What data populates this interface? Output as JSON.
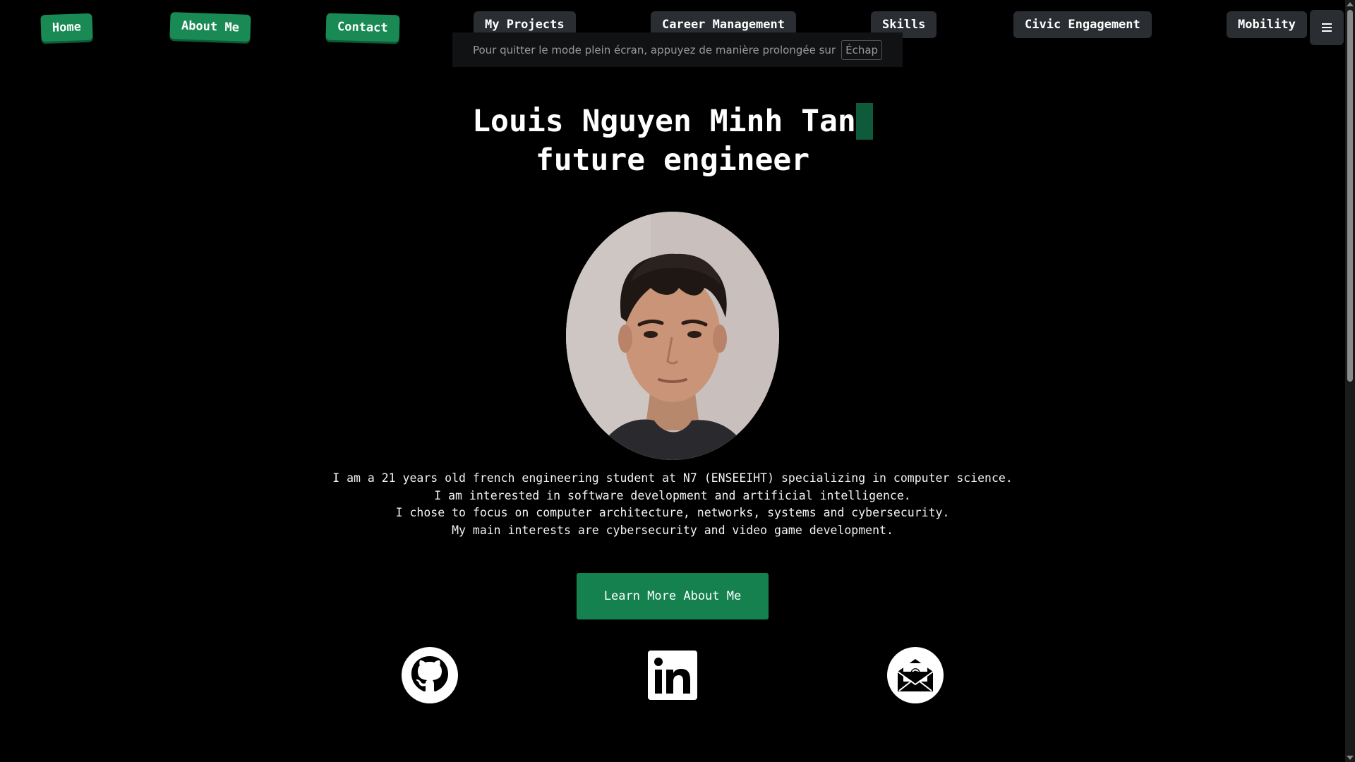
{
  "nav": {
    "home": "Home",
    "about": "About Me",
    "contact": "Contact",
    "projects": "My Projects",
    "career": "Career Management",
    "skills": "Skills",
    "civic": "Civic Engagement",
    "mobility": "Mobility",
    "menu_icon": "hamburger-menu-icon"
  },
  "fullscreen_banner": {
    "message": "Pour quitter le mode plein écran, appuyez de manière prolongée sur",
    "key": "Échap"
  },
  "hero": {
    "name": "Louis Nguyen Minh Tan",
    "tagline": "future engineer"
  },
  "bio": {
    "lines": [
      "I am a 21 years old french engineering student at N7 (ENSEEIHT) specializing in computer science.",
      "I am interested in software development and artificial intelligence.",
      "I chose to focus on computer architecture, networks, systems and cybersecurity.",
      "My main interests are cybersecurity and video game development."
    ]
  },
  "cta": {
    "label": "Learn More About Me"
  },
  "social": {
    "github": "github-icon",
    "linkedin": "linkedin-icon",
    "email": "email-envelope-icon"
  },
  "colors": {
    "background": "#000000",
    "accent_green": "#1a8a55",
    "nav_dark": "#2a2d31",
    "caret": "#0f5a3a"
  }
}
